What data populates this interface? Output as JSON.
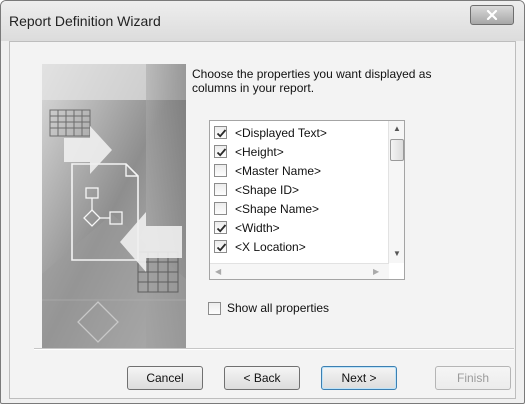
{
  "window": {
    "title": "Report Definition Wizard"
  },
  "instruction": "Choose the properties you want displayed as columns in your report.",
  "properties": [
    {
      "label": "<Displayed Text>",
      "checked": true
    },
    {
      "label": "<Height>",
      "checked": true
    },
    {
      "label": "<Master Name>",
      "checked": false
    },
    {
      "label": "<Shape ID>",
      "checked": false
    },
    {
      "label": "<Shape Name>",
      "checked": false
    },
    {
      "label": "<Width>",
      "checked": true
    },
    {
      "label": "<X Location>",
      "checked": true
    }
  ],
  "show_all": {
    "label": "Show all properties",
    "checked": false
  },
  "buttons": {
    "cancel": "Cancel",
    "back": "< Back",
    "next": "Next >",
    "finish": "Finish"
  },
  "icons": {
    "close": "close-icon",
    "check": "checkmark-icon"
  }
}
